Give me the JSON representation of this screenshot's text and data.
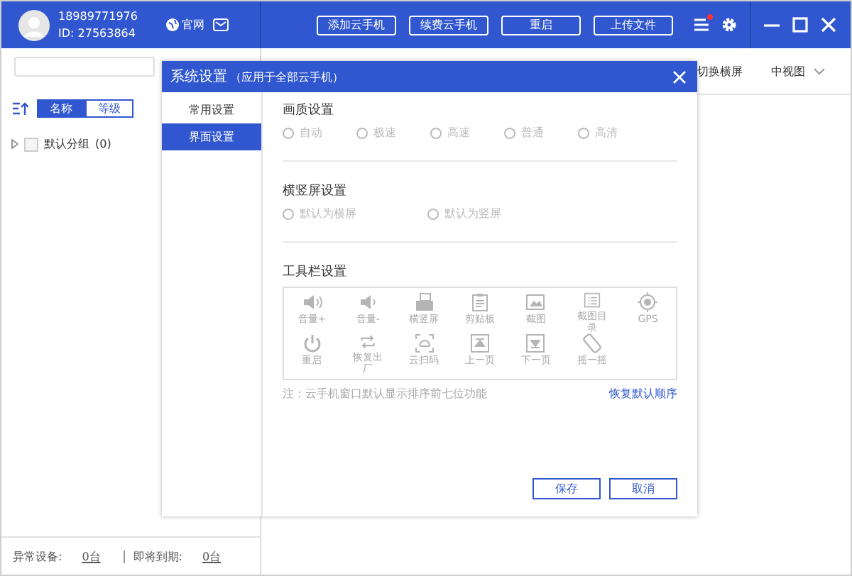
{
  "header": {
    "phone": "18989771976",
    "id": "ID: 27563864",
    "website": "官网",
    "buttons": [
      "添加云手机",
      "续费云手机",
      "重启",
      "上传文件"
    ],
    "menu_badge": true
  },
  "sidebar": {
    "sort_tabs": [
      {
        "label": "名称",
        "selected": true
      },
      {
        "label": "等级",
        "selected": false
      }
    ],
    "groups": [
      {
        "label": "默认分组",
        "count": "(0)",
        "checked": false,
        "expanded": false
      }
    ],
    "status": {
      "abnormal_label": "异常设备:",
      "abnormal_count": "0台",
      "expiring_label": "即将到期:",
      "expiring_count": "0台"
    }
  },
  "toolbar": {
    "rotate": "切换横屏",
    "view": "中视图"
  },
  "dialog": {
    "title": "系统设置",
    "subtitle": "（应用于全部云手机）",
    "nav": [
      {
        "label": "常用设置",
        "selected": false
      },
      {
        "label": "界面设置",
        "selected": true
      }
    ],
    "quality": {
      "heading": "画质设置",
      "options": [
        {
          "label": "自动",
          "selected": false,
          "disabled": true
        },
        {
          "label": "极速",
          "selected": false,
          "disabled": true
        },
        {
          "label": "高速",
          "selected": false,
          "disabled": true
        },
        {
          "label": "普通",
          "selected": false,
          "disabled": true
        },
        {
          "label": "高清",
          "selected": false,
          "disabled": true
        }
      ]
    },
    "orientation": {
      "heading": "横竖屏设置",
      "options": [
        {
          "label": "默认为横屏",
          "selected": false,
          "disabled": true
        },
        {
          "label": "默认为竖屏",
          "selected": false,
          "disabled": true
        }
      ]
    },
    "toolbar_settings": {
      "heading": "工具栏设置",
      "items": [
        "音量+",
        "音量-",
        "横竖屏",
        "剪贴板",
        "截图",
        "截图目录",
        "GPS",
        "重启",
        "恢复出厂",
        "云扫码",
        "上一页",
        "下一页",
        "摇一摇"
      ],
      "note": "注：云手机窗口默认显示排序前七位功能",
      "reset_link": "恢复默认顺序"
    },
    "buttons": [
      "保存",
      "取消"
    ]
  }
}
